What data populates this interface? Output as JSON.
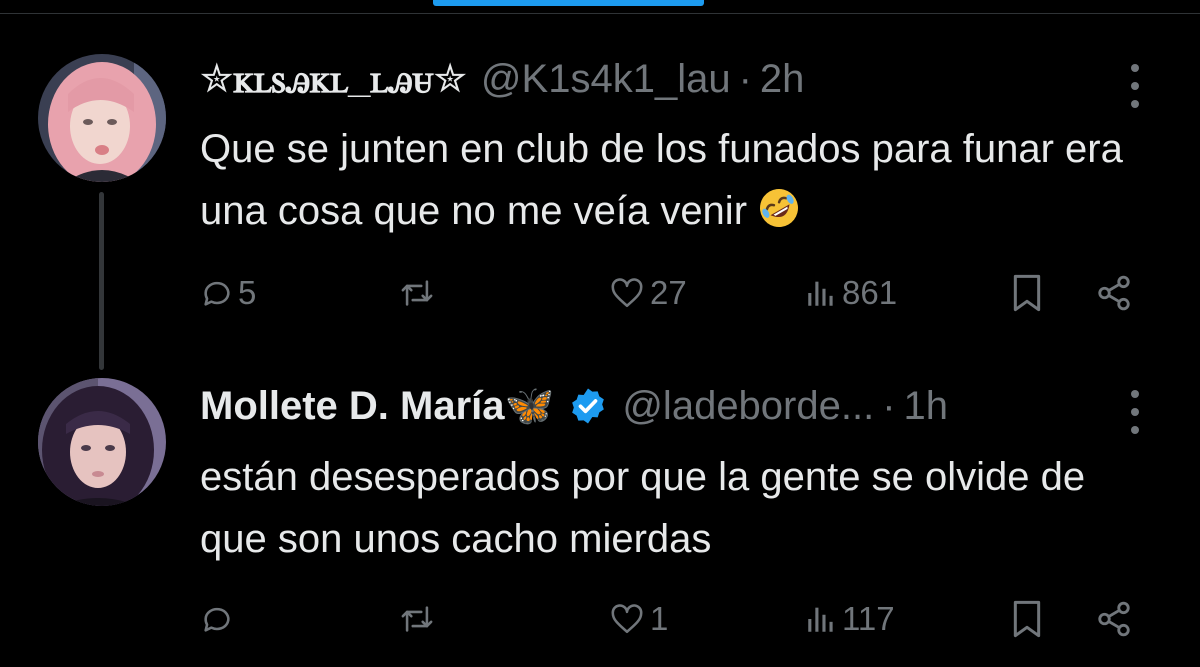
{
  "tweets": [
    {
      "display_name": "✮ꮶꮮꮪꭿꮶꮮ_ꮮꭿꮜ✮",
      "verified": false,
      "handle": "@K1s4k1_lau",
      "separator": "·",
      "time": "2h",
      "text": "Que se junten en club de los funados para funar era una cosa que no me veía venir",
      "text_emoji": "rolling-on-floor-laughing",
      "stats": {
        "replies": "5",
        "reposts": "",
        "likes": "27",
        "views": "861"
      },
      "avatar_colors": {
        "hair": "#e8a2ad",
        "skin": "#f1d6cf",
        "bg": "#3a3f52"
      }
    },
    {
      "display_name": "Mollete D. María🦋",
      "verified": true,
      "handle": "@ladeborde...",
      "separator": "·",
      "time": "1h",
      "text": "están desesperados por que la gente se olvide de que son unos cacho mierdas",
      "stats": {
        "replies": "",
        "reposts": "",
        "likes": "1",
        "views": "117"
      },
      "avatar_colors": {
        "hair": "#2a1d33",
        "skin": "#e6c3c0",
        "bg": "#7a6f95"
      }
    }
  ],
  "colors": {
    "background": "#000000",
    "text": "#e7e9ea",
    "muted": "#71767b",
    "accent": "#1d9bf0",
    "thread_line": "#333639"
  },
  "icons": {
    "reply": "reply-icon",
    "repost": "repost-icon",
    "like": "heart-icon",
    "views": "views-icon",
    "bookmark": "bookmark-icon",
    "share": "share-icon",
    "more": "more-icon",
    "verified": "verified-badge-icon"
  }
}
